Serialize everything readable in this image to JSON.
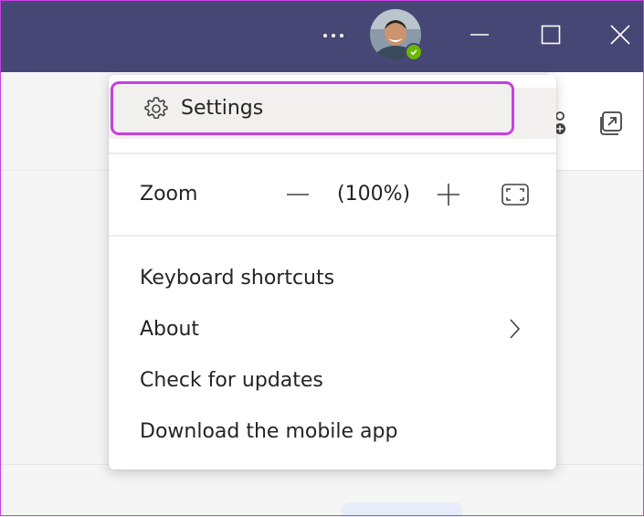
{
  "titlebar": {
    "more_icon": "more-horizontal-icon",
    "avatar_status": "available",
    "window_controls": [
      "minimize-icon",
      "maximize-icon",
      "close-icon"
    ]
  },
  "menu": {
    "settings_label": "Settings",
    "zoom_label": "Zoom",
    "zoom_value": "(100%)",
    "items": [
      {
        "label": "Keyboard shortcuts"
      },
      {
        "label": "About",
        "has_submenu": true
      },
      {
        "label": "Check for updates"
      },
      {
        "label": "Download the mobile app"
      }
    ]
  },
  "colors": {
    "titlebar": "#464775",
    "highlight": "#c63fe0",
    "status_available": "#6bb700"
  }
}
